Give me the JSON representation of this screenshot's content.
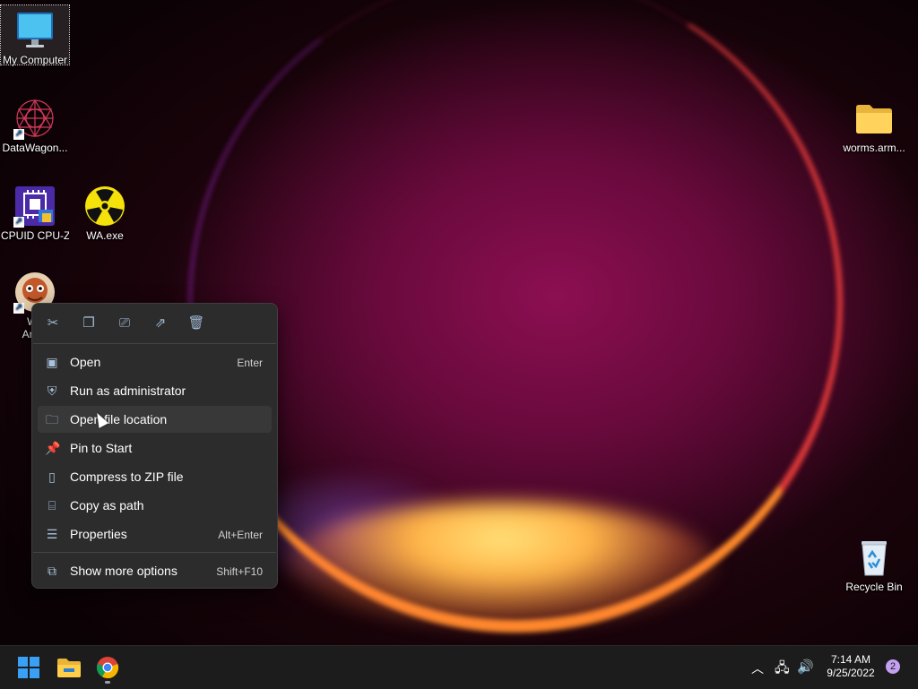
{
  "desktop": {
    "icons": [
      {
        "label": "My Computer",
        "icon": "monitor-icon"
      },
      {
        "label": "DataWagon...",
        "icon": "datawagon-icon"
      },
      {
        "label": "CPUID CPU-Z",
        "icon": "cpuz-icon"
      },
      {
        "label": "WA.exe",
        "icon": "radiation-icon"
      },
      {
        "label": "Wo",
        "label2": "Arma",
        "icon": "worms-icon"
      },
      {
        "label": "worms.arm...",
        "icon": "folder-icon"
      },
      {
        "label": "Recycle Bin",
        "icon": "recycle-bin-icon"
      }
    ]
  },
  "context_menu": {
    "toolbar": [
      {
        "name": "cut",
        "icon": "scissors-icon"
      },
      {
        "name": "copy",
        "icon": "copy-icon"
      },
      {
        "name": "rename",
        "icon": "rename-icon"
      },
      {
        "name": "share",
        "icon": "share-icon"
      },
      {
        "name": "delete",
        "icon": "trash-icon"
      }
    ],
    "items": [
      {
        "label": "Open",
        "shortcut": "Enter",
        "icon": "open-window-icon"
      },
      {
        "label": "Run as administrator",
        "shortcut": "",
        "icon": "shield-icon"
      },
      {
        "label": "Open file location",
        "shortcut": "",
        "icon": "folder-outline-icon"
      },
      {
        "label": "Pin to Start",
        "shortcut": "",
        "icon": "pin-icon"
      },
      {
        "label": "Compress to ZIP file",
        "shortcut": "",
        "icon": "zip-icon"
      },
      {
        "label": "Copy as path",
        "shortcut": "",
        "icon": "path-icon"
      },
      {
        "label": "Properties",
        "shortcut": "Alt+Enter",
        "icon": "properties-icon"
      }
    ],
    "more": {
      "label": "Show more options",
      "shortcut": "Shift+F10",
      "icon": "more-options-icon"
    }
  },
  "taskbar": {
    "apps": [
      {
        "name": "start",
        "icon": "windows-logo-icon"
      },
      {
        "name": "file-explorer",
        "icon": "file-explorer-icon"
      },
      {
        "name": "chrome",
        "icon": "chrome-icon"
      }
    ],
    "clock": {
      "time": "7:14 AM",
      "date": "9/25/2022"
    },
    "notification_count": "2",
    "colors": {
      "accent": "#0078d4",
      "badge": "#c4a0f0"
    }
  }
}
